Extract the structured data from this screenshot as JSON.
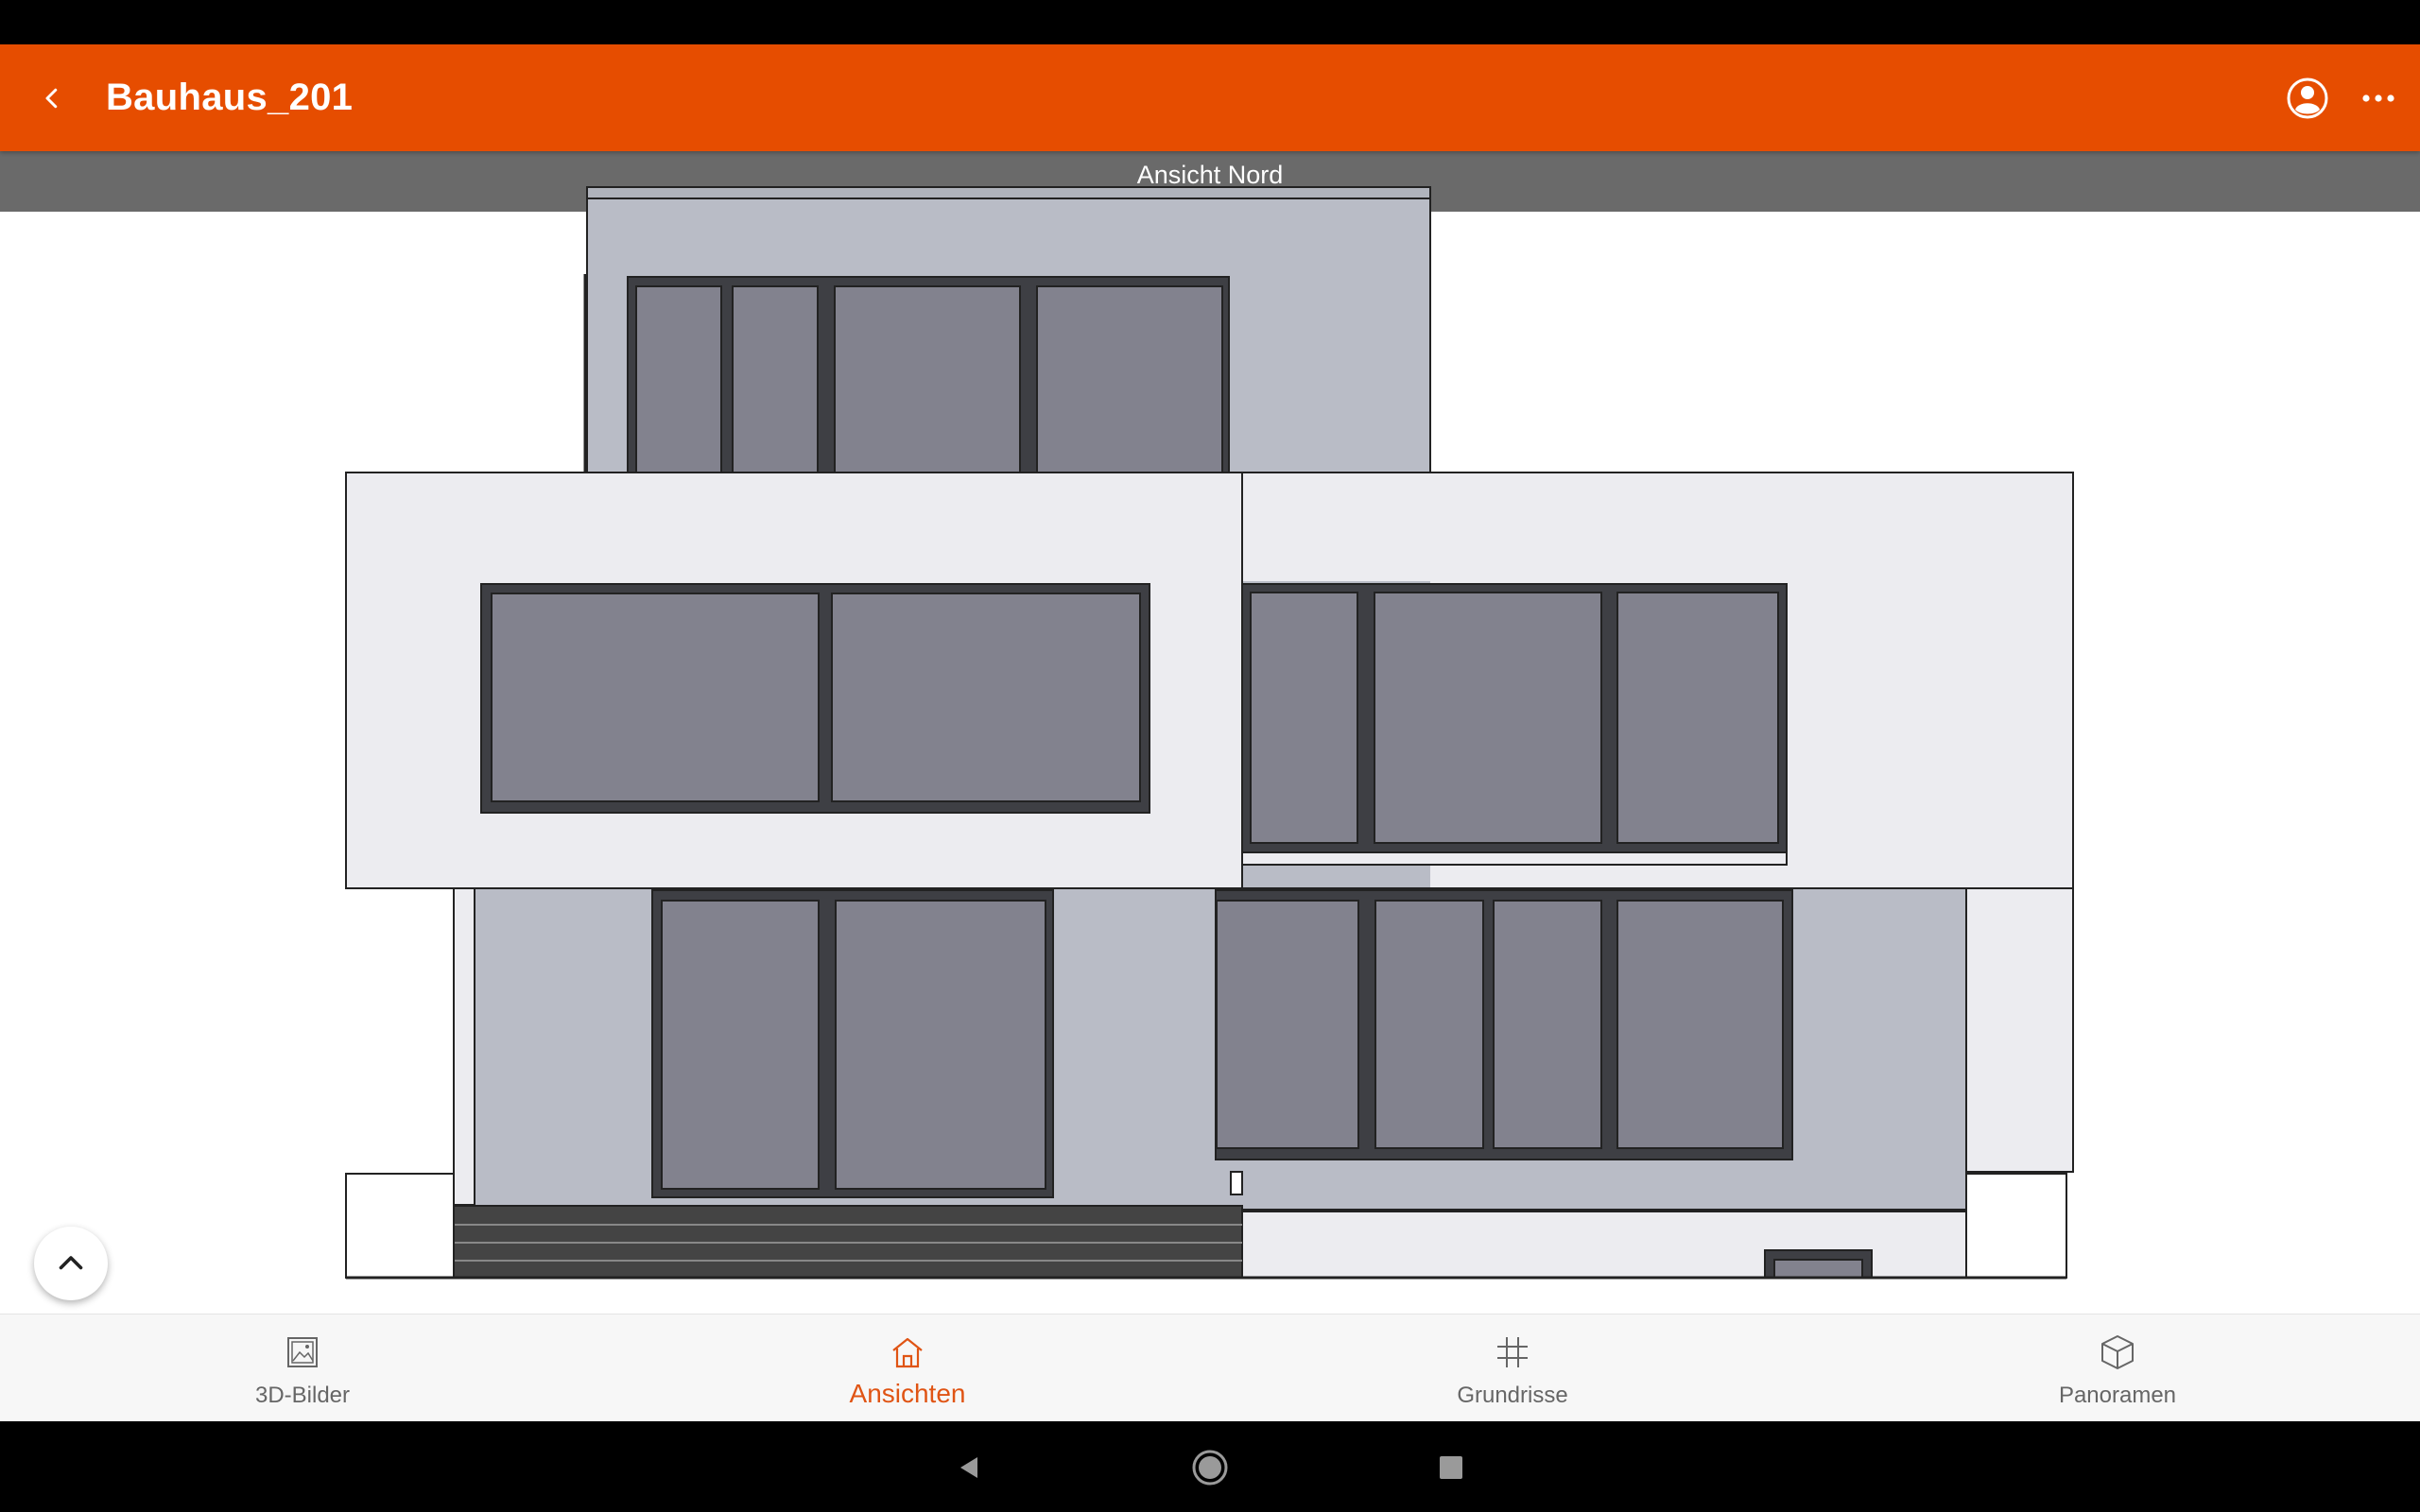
{
  "app_bar": {
    "title": "Bauhaus_201",
    "back_icon": "chevron-left-icon",
    "profile_icon": "account-icon",
    "more_icon": "more-horizontal-icon",
    "color": "#e64d00"
  },
  "view": {
    "title": "Ansicht Nord"
  },
  "bottom_nav": {
    "items": [
      {
        "label": "3D-Bilder",
        "icon": "image-icon",
        "active": false
      },
      {
        "label": "Ansichten",
        "icon": "house-icon",
        "active": true
      },
      {
        "label": "Grundrisse",
        "icon": "grid-icon",
        "active": false
      },
      {
        "label": "Panoramen",
        "icon": "cube-icon",
        "active": false
      }
    ],
    "active_color": "#e05414"
  },
  "system_nav": {
    "back_icon": "triangle-back-icon",
    "home_icon": "circle-home-icon",
    "recents_icon": "square-recents-icon"
  }
}
